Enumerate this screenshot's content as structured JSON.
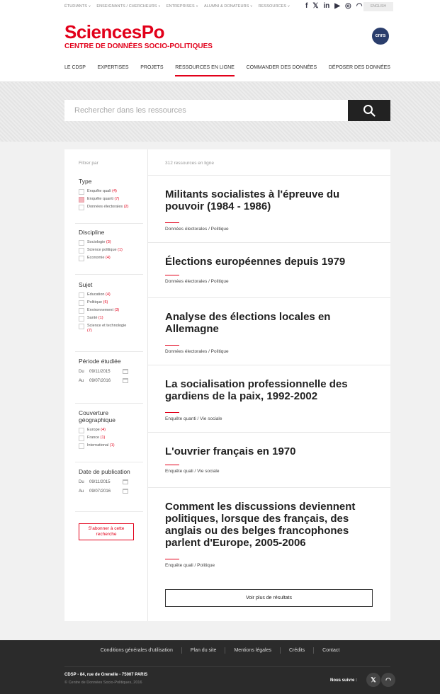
{
  "topbar": {
    "links": [
      "ÉTUDIANTS",
      "ENSEIGNANTS / CHERCHEURS",
      "ENTREPRISES",
      "ALUMNI & DONATEURS",
      "RESSOURCES"
    ],
    "social": [
      "f",
      "𝕏",
      "in",
      "▶",
      "◎",
      "◠"
    ],
    "language": "ENGLISH"
  },
  "header": {
    "logo": "SciencesPo",
    "subtitle": "CENTRE DE DONNÉES SOCIO-POLITIQUES",
    "partner_logo": "cnrs",
    "nav": [
      "LE CDSP",
      "EXPERTISES",
      "PROJETS",
      "RESSOURCES EN LIGNE",
      "COMMANDER DES DONNÉES",
      "DÉPOSER DES DONNÉES"
    ],
    "active_nav": "RESSOURCES EN LIGNE"
  },
  "search": {
    "placeholder": "Rechercher dans les ressources",
    "icon": "search-icon"
  },
  "filters": {
    "label": "Filtrer par",
    "type": {
      "title": "Type",
      "options": [
        {
          "label": "Enquête quali",
          "count": "(4)",
          "checked": false
        },
        {
          "label": "Enquête quanti",
          "count": "(7)",
          "checked": true
        },
        {
          "label": "Données électorales",
          "count": "(2)",
          "checked": false
        }
      ]
    },
    "discipline": {
      "title": "Discipline",
      "options": [
        {
          "label": "Sociologie",
          "count": "(3)"
        },
        {
          "label": "Science politique",
          "count": "(1)"
        },
        {
          "label": "Economie",
          "count": "(4)"
        }
      ]
    },
    "sujet": {
      "title": "Sujet",
      "options": [
        {
          "label": "Education",
          "count": "(4)"
        },
        {
          "label": "Politique",
          "count": "(6)"
        },
        {
          "label": "Environnement",
          "count": "(3)"
        },
        {
          "label": "Santé",
          "count": "(1)"
        },
        {
          "label": "Science et technologie",
          "count": "(7)"
        }
      ]
    },
    "periode": {
      "title": "Période étudiée",
      "from_label": "Du",
      "from": "09/11/2015",
      "to_label": "Au",
      "to": "09/07/2016"
    },
    "couverture": {
      "title": "Couverture géographique",
      "options": [
        {
          "label": "Europe",
          "count": "(4)"
        },
        {
          "label": "France",
          "count": "(1)"
        },
        {
          "label": "International",
          "count": "(1)"
        }
      ]
    },
    "publication": {
      "title": "Date de publication",
      "from_label": "Du",
      "from": "09/11/2015",
      "to_label": "Au",
      "to": "09/07/2016"
    },
    "subscribe": "S'abonner à cette recherche"
  },
  "results": {
    "count": "312 ressources en ligne",
    "items": [
      {
        "title": "Militants socialistes à l'épreuve du pouvoir (1984 - 1986)",
        "meta": "Données électorales / Politique"
      },
      {
        "title": "Élections européennes depuis 1979",
        "meta": "Données électorales / Politique"
      },
      {
        "title": "Analyse des élections locales en Allemagne",
        "meta": "Données électorales / Politique"
      },
      {
        "title": "La socialisation professionnelle des gardiens de la paix, 1992-2002",
        "meta": "Enquête quanti / Vie sociale"
      },
      {
        "title": "L'ouvrier français en 1970",
        "meta": "Enquête quali / Vie sociale"
      },
      {
        "title": "Comment les discussions deviennent politiques, lorsque des français, des anglais ou des belges francophones parlent d'Europe, 2005-2006",
        "meta": "Enquête quali / Politique"
      }
    ],
    "more": "Voir plus de résultats"
  },
  "footer": {
    "links": [
      "Conditions générales d'utilisation",
      "Plan du site",
      "Mentions légales",
      "Crédits",
      "Contact"
    ],
    "address": "CDSP - 84, rue de Grenelle - 75007 PARIS",
    "copyright": "© Centre de Données Socio-Politiques, 2016",
    "follow": "Nous suivre :",
    "twitter": "𝕏",
    "rss": "◠"
  }
}
